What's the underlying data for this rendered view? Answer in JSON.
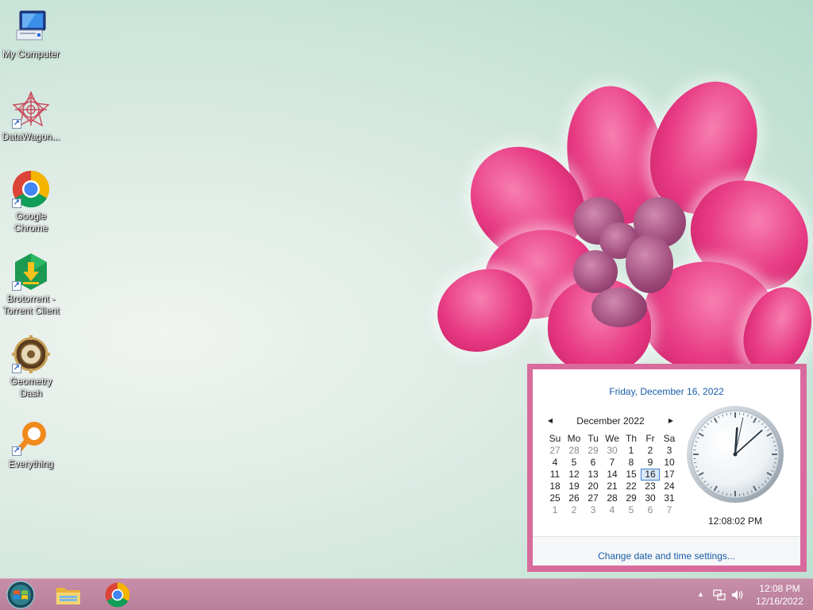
{
  "desktop": {
    "icons": [
      {
        "label": "My Computer",
        "icon": "my-computer-icon"
      },
      {
        "label": "DataWagon...",
        "icon": "datawagon-icon"
      },
      {
        "label": "Google Chrome",
        "icon": "chrome-icon"
      },
      {
        "label": "Brotorrent - Torrent Client",
        "icon": "brotorrent-icon"
      },
      {
        "label": "Geometry Dash",
        "icon": "geometry-dash-icon"
      },
      {
        "label": "Everything",
        "icon": "everything-icon"
      }
    ]
  },
  "calendar": {
    "date_header": "Friday, December 16, 2022",
    "month_title": "December 2022",
    "weekdays": [
      "Su",
      "Mo",
      "Tu",
      "We",
      "Th",
      "Fr",
      "Sa"
    ],
    "weeks": [
      [
        "27",
        "28",
        "29",
        "30",
        "1",
        "2",
        "3"
      ],
      [
        "4",
        "5",
        "6",
        "7",
        "8",
        "9",
        "10"
      ],
      [
        "11",
        "12",
        "13",
        "14",
        "15",
        "16",
        "17"
      ],
      [
        "18",
        "19",
        "20",
        "21",
        "22",
        "23",
        "24"
      ],
      [
        "25",
        "26",
        "27",
        "28",
        "29",
        "30",
        "31"
      ],
      [
        "1",
        "2",
        "3",
        "4",
        "5",
        "6",
        "7"
      ]
    ],
    "today": "16",
    "digital_time": "12:08:02 PM",
    "change_link": "Change date and time settings..."
  },
  "taskbar": {
    "pinned": [
      "file-explorer-icon",
      "chrome-icon"
    ],
    "clock_time": "12:08 PM",
    "clock_date": "12/16/2022"
  },
  "colors": {
    "accent": "#d86a9c",
    "taskbar": "#c88ea9",
    "link": "#1a5ea8"
  }
}
